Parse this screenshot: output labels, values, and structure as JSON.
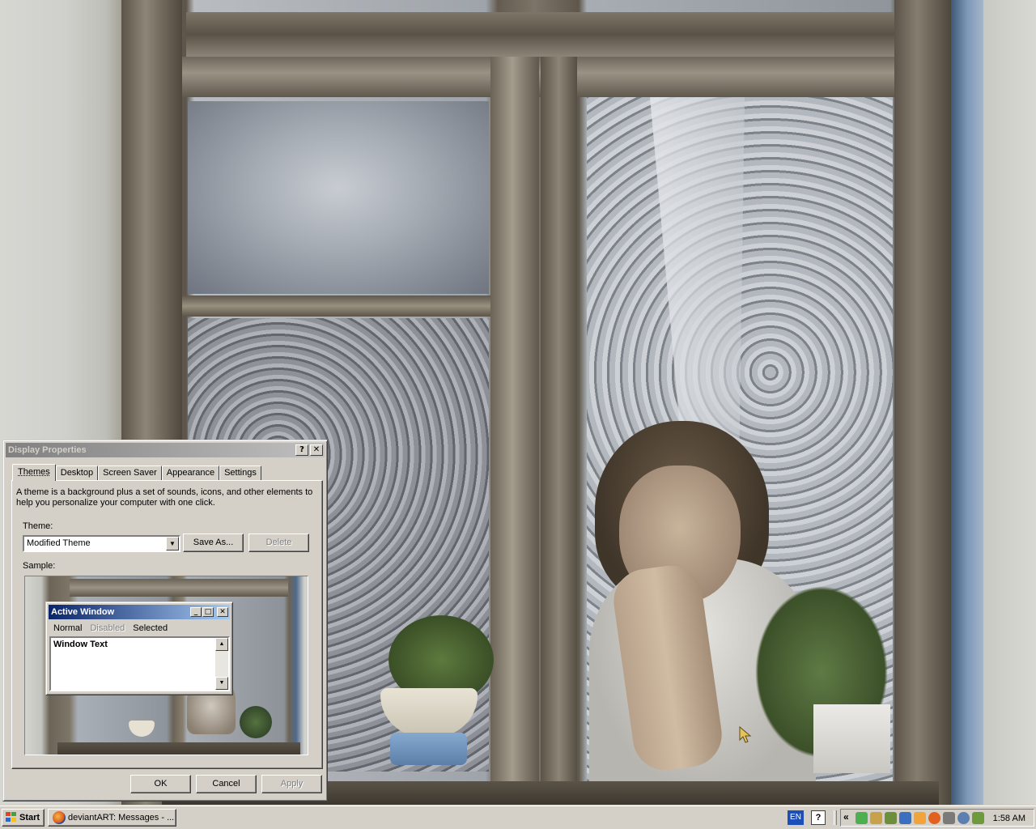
{
  "dialog": {
    "title": "Display Properties",
    "help_button": "?",
    "close_button": "✕",
    "tabs": [
      "Themes",
      "Desktop",
      "Screen Saver",
      "Appearance",
      "Settings"
    ],
    "active_tab": "Themes",
    "description": "A theme is a background plus a set of sounds, icons, and other elements to help you personalize your computer with one click.",
    "theme_label": "Theme:",
    "theme_value": "Modified Theme",
    "save_as_label": "Save As...",
    "delete_label": "Delete",
    "sample_label": "Sample:",
    "sample_window": {
      "title": "Active Window",
      "menu": {
        "normal": "Normal",
        "disabled": "Disabled",
        "selected": "Selected"
      },
      "text": "Window Text"
    },
    "ok_label": "OK",
    "cancel_label": "Cancel",
    "apply_label": "Apply"
  },
  "taskbar": {
    "start_label": "Start",
    "task_button_label": "deviantART: Messages - ...",
    "language": "EN",
    "help_icon": "?",
    "tray_chevron": "«",
    "clock": "1:58 AM",
    "tray_icons": [
      "shield-icon",
      "hand-icon",
      "network-icon",
      "speaker-icon",
      "update-icon",
      "firefox-icon",
      "antivirus-icon",
      "sync-icon",
      "tools-icon"
    ]
  },
  "colors": {
    "inactive_title_start": "#808080",
    "inactive_title_end": "#c0c0c0",
    "active_title_start": "#0a246a",
    "active_title_end": "#a6caf0",
    "face": "#d4d0c8"
  }
}
